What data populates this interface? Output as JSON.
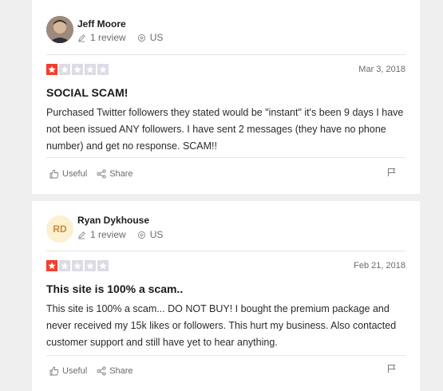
{
  "reviews": [
    {
      "reviewer": {
        "name": "Jeff Moore",
        "reviews": "1 review",
        "country": "US",
        "avatar_type": "photo"
      },
      "rating": 1,
      "date": "Mar 3, 2018",
      "title": "SOCIAL SCAM!",
      "body": "Purchased Twitter followers they stated would be \"instant\" it's been 9 days I have not been issued ANY followers. I have sent 2 messages (they have no phone number) and get no response. SCAM!!",
      "useful_label": "Useful",
      "share_label": "Share"
    },
    {
      "reviewer": {
        "name": "Ryan Dykhouse",
        "reviews": "1 review",
        "country": "US",
        "initials": "RD",
        "avatar_type": "initials"
      },
      "rating": 1,
      "date": "Feb 21, 2018",
      "title": "This site is 100% a scam..",
      "body": "This site is 100% a scam... DO NOT BUY! I bought the premium package and never received my 15k likes or followers. This hurt my business. Also contacted customer support and still have yet to hear anything.",
      "useful_label": "Useful",
      "share_label": "Share"
    }
  ],
  "colors": {
    "star_on": "#f23e2e",
    "star_off": "#dcdce6",
    "background": "#efefef"
  }
}
